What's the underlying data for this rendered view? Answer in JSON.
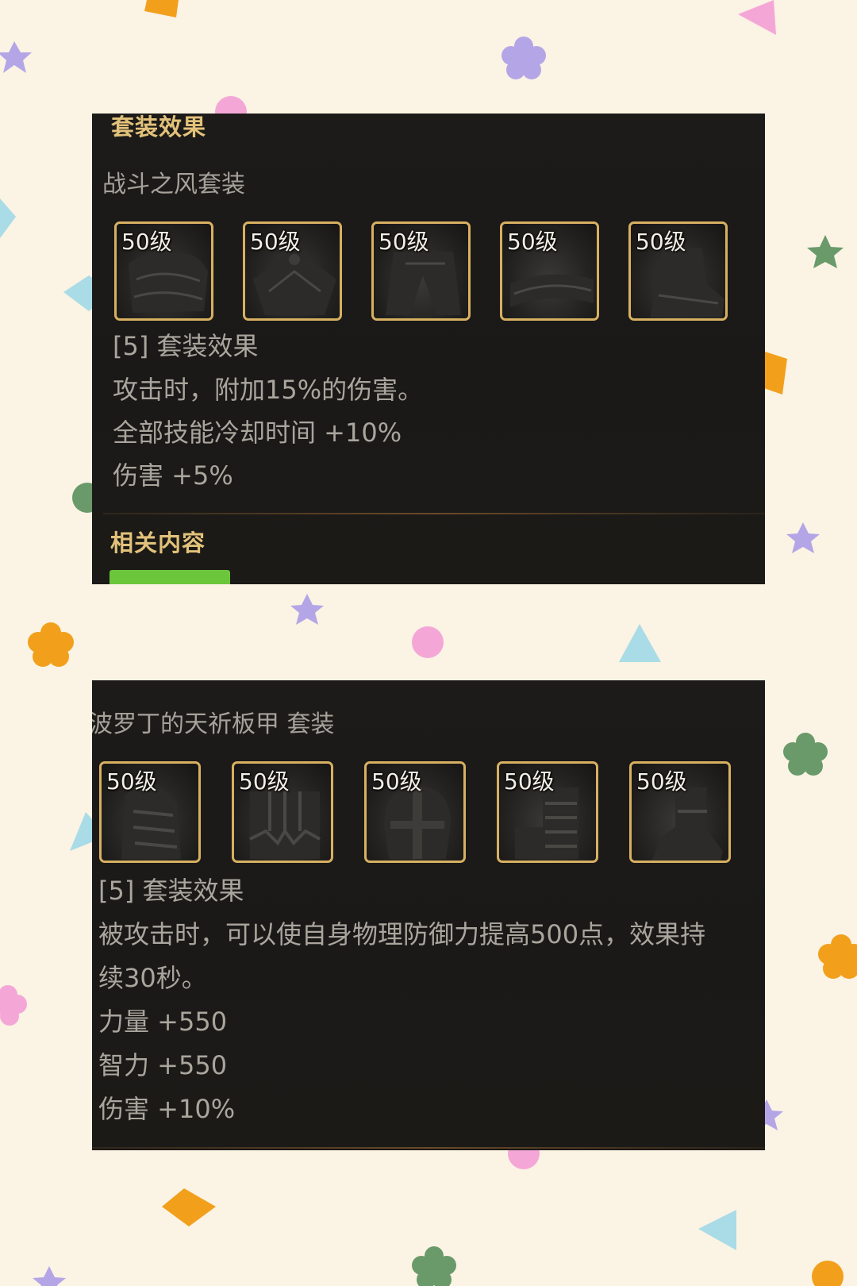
{
  "panels": [
    {
      "heading": "套装效果",
      "set_name": "战斗之风套装",
      "slots": [
        "50级",
        "50级",
        "50级",
        "50级",
        "50级"
      ],
      "effect_title": "[5] 套装效果",
      "effects": [
        "攻击时，附加15%的伤害。",
        "全部技能冷却时间 +10%",
        "伤害 +5%"
      ],
      "related_heading": "相关内容"
    },
    {
      "set_name": "波罗丁的天祈板甲  套装",
      "slots": [
        "50级",
        "50级",
        "50级",
        "50级",
        "50级"
      ],
      "effect_title": "[5] 套装效果",
      "effects": [
        "被攻击时，可以使自身物理防御力提高500点，效果持",
        "续30秒。",
        "力量 +550",
        "智力 +550",
        "伤害 +10%"
      ]
    }
  ],
  "colors": {
    "background": "#fbf3e4",
    "panel": "#1c1a18",
    "slot_border": "#d8b061",
    "heading_gold": "#e2c27a",
    "text_grey": "#aaa59d",
    "tag_green": "#6cc63c"
  }
}
